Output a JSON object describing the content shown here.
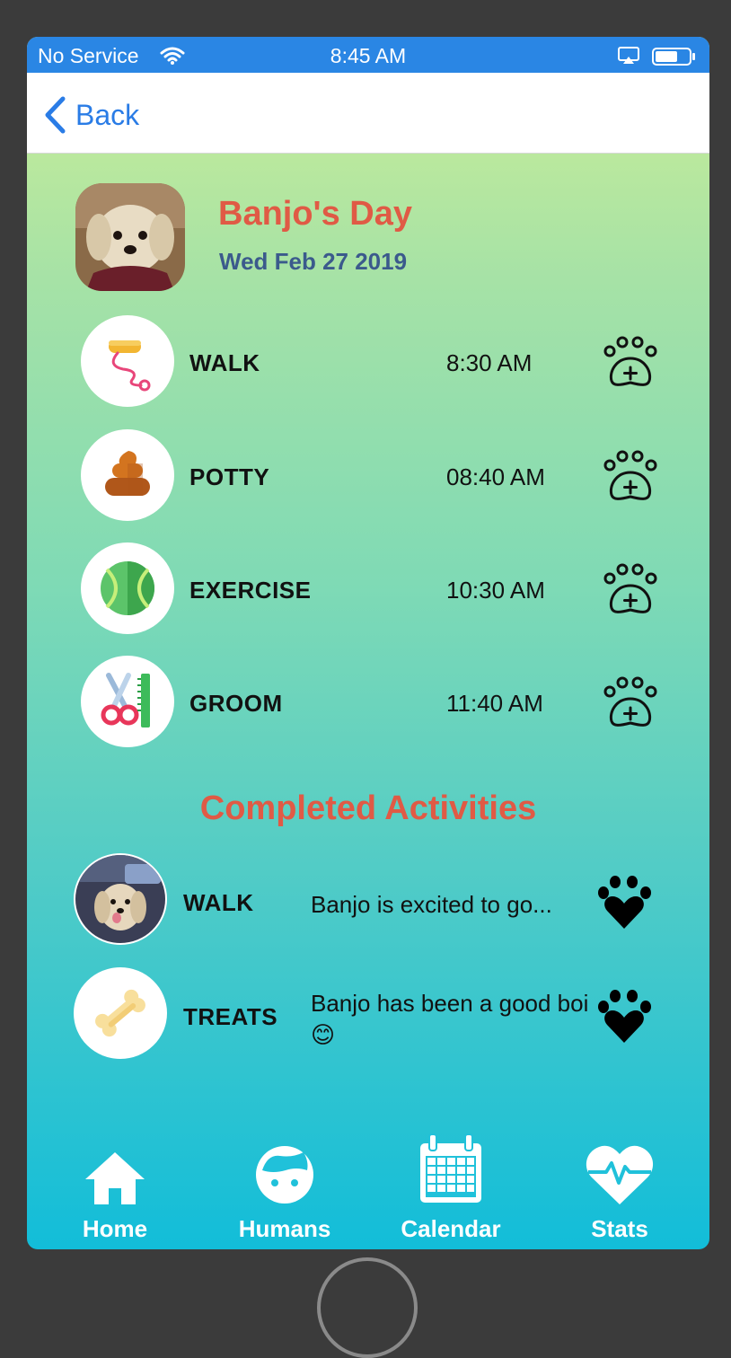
{
  "status_bar": {
    "carrier": "No Service",
    "time": "8:45 AM"
  },
  "nav": {
    "back_label": "Back"
  },
  "header": {
    "title": "Banjo's Day",
    "date": "Wed Feb 27 2019"
  },
  "activities": [
    {
      "label": "WALK",
      "time": "8:30 AM",
      "icon": "leash-icon"
    },
    {
      "label": "POTTY",
      "time": "08:40 AM",
      "icon": "poop-icon"
    },
    {
      "label": "EXERCISE",
      "time": "10:30 AM",
      "icon": "tennis-ball-icon"
    },
    {
      "label": "GROOM",
      "time": "11:40 AM",
      "icon": "grooming-scissors-comb-icon"
    }
  ],
  "completed": {
    "heading": "Completed Activities",
    "items": [
      {
        "label": "WALK",
        "note": "Banjo is excited to go...",
        "icon": "dog-photo-thumbnail"
      },
      {
        "label": "TREATS",
        "note": "Banjo has been a good boi 😊",
        "icon": "bone-icon"
      }
    ]
  },
  "tabs": [
    {
      "label": "Home",
      "icon": "home-icon"
    },
    {
      "label": "Humans",
      "icon": "face-icon"
    },
    {
      "label": "Calendar",
      "icon": "calendar-icon"
    },
    {
      "label": "Stats",
      "icon": "heartbeat-icon"
    }
  ],
  "colors": {
    "status_bar": "#2a86e4",
    "accent_title": "#e05a45",
    "date_text": "#3b5a8c",
    "back_link": "#2a7ce6",
    "gradient_top": "#cdee96",
    "gradient_bottom": "#12bdd9"
  }
}
